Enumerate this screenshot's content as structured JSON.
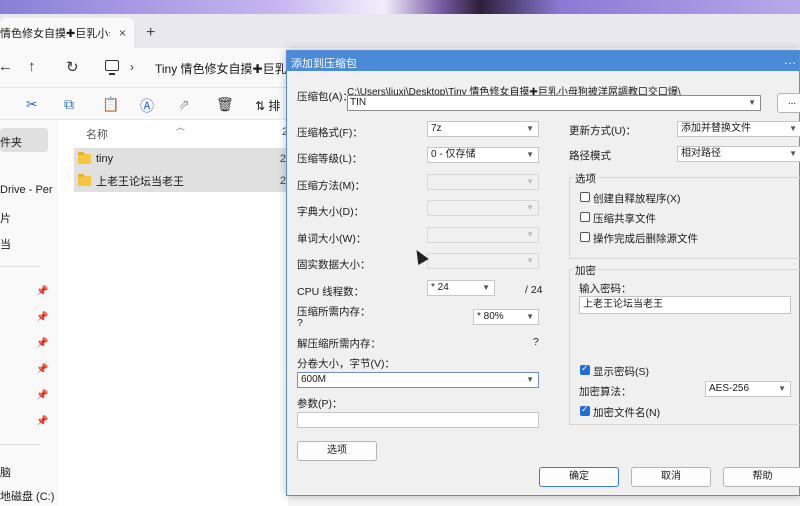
{
  "browser": {
    "tab_title": "情色修女自摸✚巨乳小母",
    "tab_close": "×",
    "new_tab": "+"
  },
  "explorer": {
    "address_path": "Tiny 情色修女自摸✚巨乳",
    "address_chevron": "›",
    "sort_label": "排",
    "column_name": "名称",
    "column_extra": "2",
    "files": [
      {
        "name": "tiny",
        "extra": "2"
      },
      {
        "name": "上老王论坛当老王",
        "extra": "2"
      }
    ],
    "sidebar": {
      "folder_label": "件夹",
      "onedrive_label": "Drive - Per",
      "item_pian": "片",
      "item_dang": "当",
      "item_nao": "脑",
      "local_disk": "地磁盘 (C:)"
    }
  },
  "dialog": {
    "title": "添加到压缩包",
    "more": "...",
    "archive_label": "压缩包(A)：",
    "archive_path": "C:\\Users\\liuxi\\Desktop\\Tiny 情色修女自摸✚巨乳小母狗被洋屌調教口交口爆\\",
    "archive_name": "TIN",
    "browse_label": "...",
    "format_label": "压缩格式(F)：",
    "format_value": "7z",
    "level_label": "压缩等级(L)：",
    "level_value": "0 - 仅存储",
    "method_label": "压缩方法(M)：",
    "dict_label": "字典大小(D)：",
    "word_label": "单词大小(W)：",
    "solid_label": "固实数据大小：",
    "cpu_label": "CPU 线程数：",
    "cpu_value": "* 24",
    "cpu_max": "/ 24",
    "mem_label": "压缩所需内存：",
    "mem_value": "?",
    "mem_percent": "* 80%",
    "decomp_label": "解压缩所需内存：",
    "decomp_value": "?",
    "volume_label": "分卷大小，字节(V)：",
    "volume_value": "600M",
    "params_label": "参数(P)：",
    "params_value": "",
    "options_button": "选项",
    "update_label": "更新方式(U)：",
    "update_value": "添加并替换文件",
    "path_mode_label": "路径模式",
    "path_mode_value": "相对路径",
    "options_group": "选项",
    "opt_sfx": "创建自释放程序(X)",
    "opt_shared": "压缩共享文件",
    "opt_delete": "操作完成后删除源文件",
    "encrypt_group": "加密",
    "password_label": "输入密码：",
    "password_value": "上老王论坛当老王",
    "show_password": "显示密码(S)",
    "enc_method_label": "加密算法：",
    "enc_method_value": "AES-256",
    "encrypt_names": "加密文件名(N)",
    "ok_button": "确定",
    "cancel_button": "取消",
    "help_button": "帮助"
  }
}
